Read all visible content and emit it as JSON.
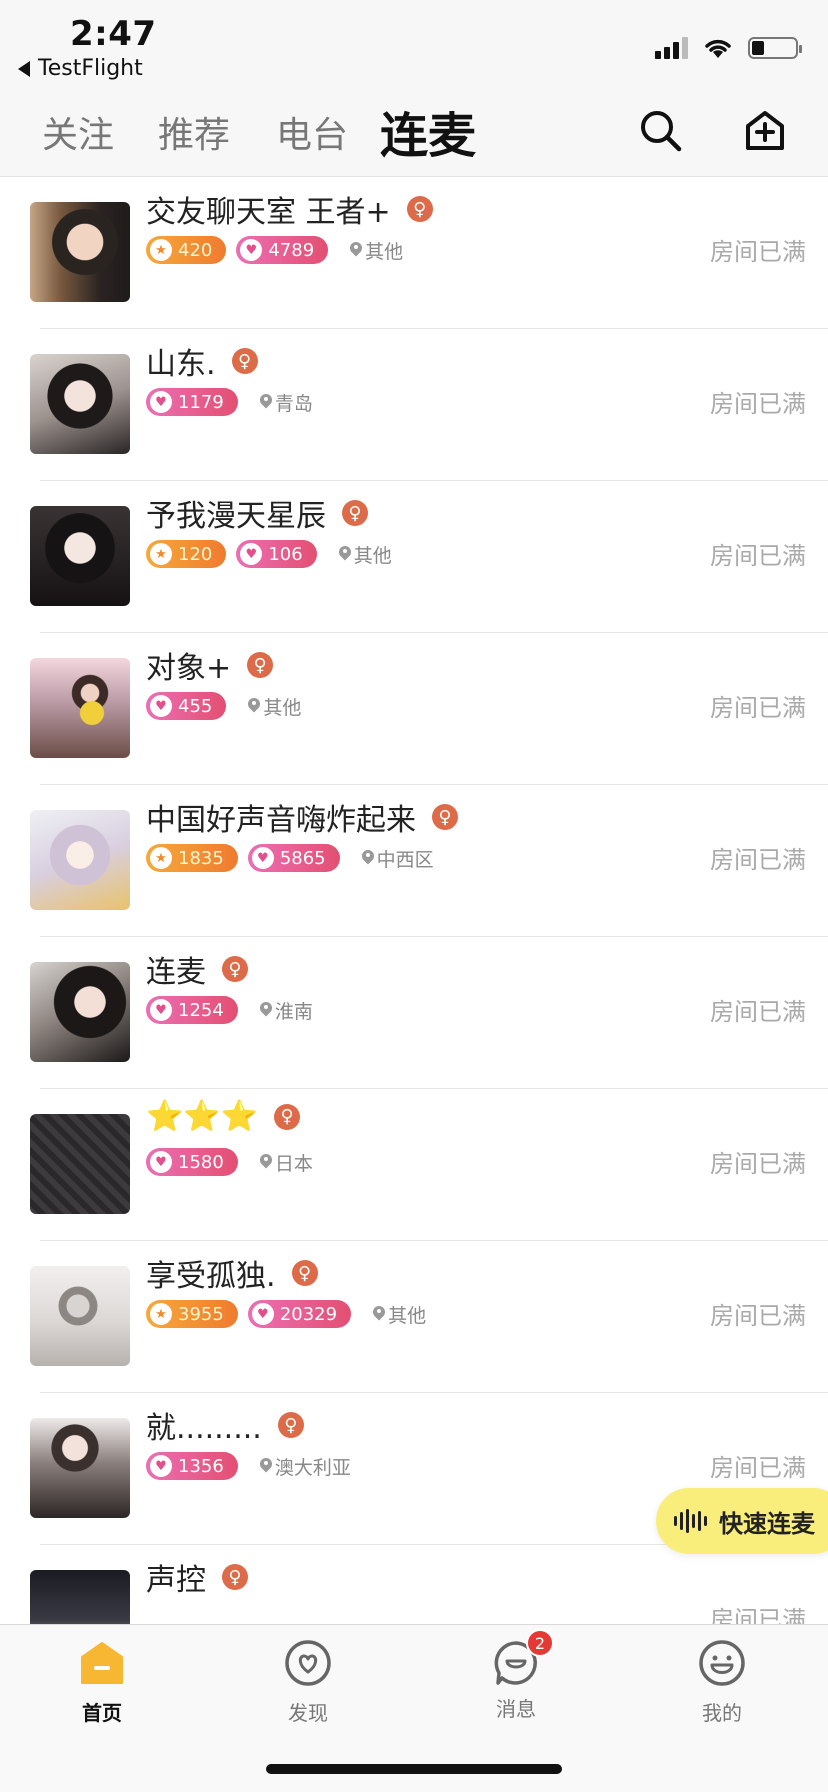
{
  "status_bar": {
    "time": "2:47",
    "back_app": "TestFlight"
  },
  "top_nav": {
    "tabs": [
      {
        "label": "关注"
      },
      {
        "label": "推荐"
      },
      {
        "label": "电台"
      },
      {
        "label": "连麦"
      }
    ],
    "active_tab": "连麦",
    "search_icon": "search-icon",
    "create_room_icon": "home-plus-icon"
  },
  "rooms": [
    {
      "title": "交友聊天室 王者+",
      "level": "420",
      "hearts": "4789",
      "location": "其他",
      "status": "房间已满"
    },
    {
      "title": "山东.",
      "level": "",
      "hearts": "1179",
      "location": "青岛",
      "status": "房间已满"
    },
    {
      "title": "予我漫天星辰",
      "level": "120",
      "hearts": "106",
      "location": "其他",
      "status": "房间已满"
    },
    {
      "title": "对象+",
      "level": "",
      "hearts": "455",
      "location": "其他",
      "status": "房间已满"
    },
    {
      "title": "中国好声音嗨炸起来",
      "level": "1835",
      "hearts": "5865",
      "location": "中西区",
      "status": "房间已满"
    },
    {
      "title": "连麦",
      "level": "",
      "hearts": "1254",
      "location": "淮南",
      "status": "房间已满"
    },
    {
      "title": "⭐⭐⭐",
      "level": "",
      "hearts": "1580",
      "location": "日本",
      "status": "房间已满"
    },
    {
      "title": "享受孤独.",
      "level": "3955",
      "hearts": "20329",
      "location": "其他",
      "status": "房间已满"
    },
    {
      "title": "就.........",
      "level": "",
      "hearts": "1356",
      "location": "澳大利亚",
      "status": "房间已满"
    },
    {
      "title": "声控",
      "level": "",
      "hearts": "",
      "location": "",
      "status": "房间已满"
    }
  ],
  "gender_symbol": "♀",
  "quick_connect": {
    "label": "快速连麦"
  },
  "bottom_tabs": [
    {
      "label": "首页",
      "icon": "home-icon"
    },
    {
      "label": "发现",
      "icon": "discover-heart-icon"
    },
    {
      "label": "消息",
      "icon": "message-icon",
      "badge": "2"
    },
    {
      "label": "我的",
      "icon": "profile-smile-icon"
    }
  ],
  "colors": {
    "accent_yellow": "#f9ed7c",
    "home_icon_orange": "#f7b733",
    "gender_badge": "#dd6b4a",
    "level_badge": "#ef7b2f",
    "heart_badge": "#e34f72",
    "notification_red": "#e53935"
  }
}
